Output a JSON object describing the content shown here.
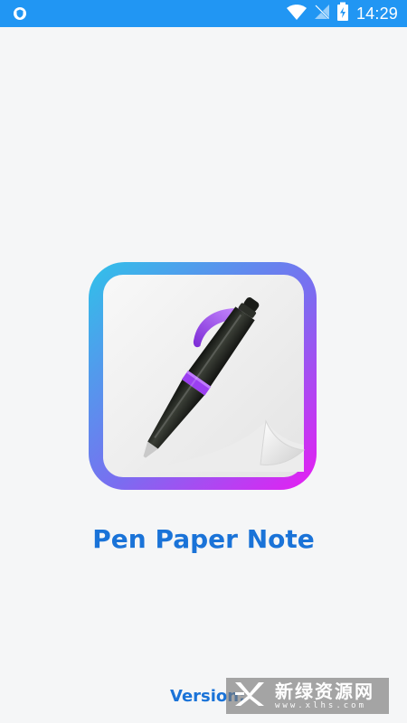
{
  "status_bar": {
    "time": "14:29"
  },
  "app": {
    "title": "Pen Paper Note",
    "version_label": "Version:"
  },
  "watermark": {
    "cn_text": "新绿资源网",
    "url_text": "www.xlhs.com"
  },
  "colors": {
    "status_bar_bg": "#2196f3",
    "background": "#f5f6f7",
    "title": "#1a73d8",
    "icon_gradient_start": "#2fc2e9",
    "icon_gradient_end": "#e81cf3",
    "pen_accent": "#9b3ff0"
  },
  "icons": {
    "status_left": "shield-icon",
    "wifi": "wifi-icon",
    "signal": "no-signal-icon",
    "battery": "battery-charging-icon",
    "app_icon": "pen-paper-icon",
    "watermark_logo": "xlhs-logo-icon"
  }
}
